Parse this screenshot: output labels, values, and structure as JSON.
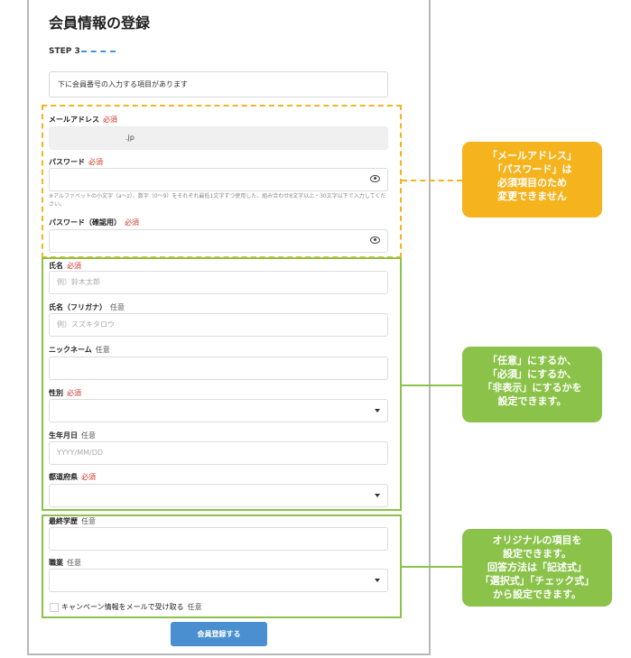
{
  "form": {
    "title": "会員情報の登録",
    "step_label": "STEP 3",
    "notice": "下に会員番号の入力する項目があります",
    "required_tag": "必須",
    "optional_tag": "任意",
    "email": {
      "label": "メールアドレス",
      "value": ".jp"
    },
    "password": {
      "label": "パスワード",
      "hint": "※アルファベットの小文字（a〜z）、数字（0〜9）をそれぞれ最低1文字ずつ使用した、組み合わせ8文字以上・30文字以下で入力してください。"
    },
    "password_confirm": {
      "label": "パスワード（確認用）"
    },
    "name": {
      "label": "氏名",
      "placeholder": "例）鈴木太郎"
    },
    "name_kana": {
      "label": "氏名（フリガナ）",
      "placeholder": "例）スズキタロウ"
    },
    "nickname": {
      "label": "ニックネーム"
    },
    "gender": {
      "label": "性別"
    },
    "birthdate": {
      "label": "生年月日",
      "placeholder": "YYYY/MM/DD"
    },
    "prefecture": {
      "label": "都道府県"
    },
    "education": {
      "label": "最終学歴"
    },
    "occupation": {
      "label": "職業"
    },
    "campaign": {
      "label": "キャンペーン情報をメールで受け取る"
    },
    "submit_label": "会員登録する"
  },
  "annotations": {
    "fixed_fields": [
      "「メールアドレス」",
      "「パスワード」は",
      "必須項目のため",
      "変更できません"
    ],
    "configurable_fields": [
      "「任意」にするか、",
      "「必須」にするか、",
      "「非表示」にするかを",
      "設定できます。"
    ],
    "custom_fields": [
      "オリジナルの項目を",
      "設定できます。",
      "回答方法は「記述式」",
      "「選択式」「チェック式」",
      "から設定できます。"
    ]
  },
  "colors": {
    "required": "#d0342c",
    "accent_blue": "#4a8fcf",
    "annotation_orange": "#f5b31e",
    "annotation_green": "#8bc34a"
  }
}
